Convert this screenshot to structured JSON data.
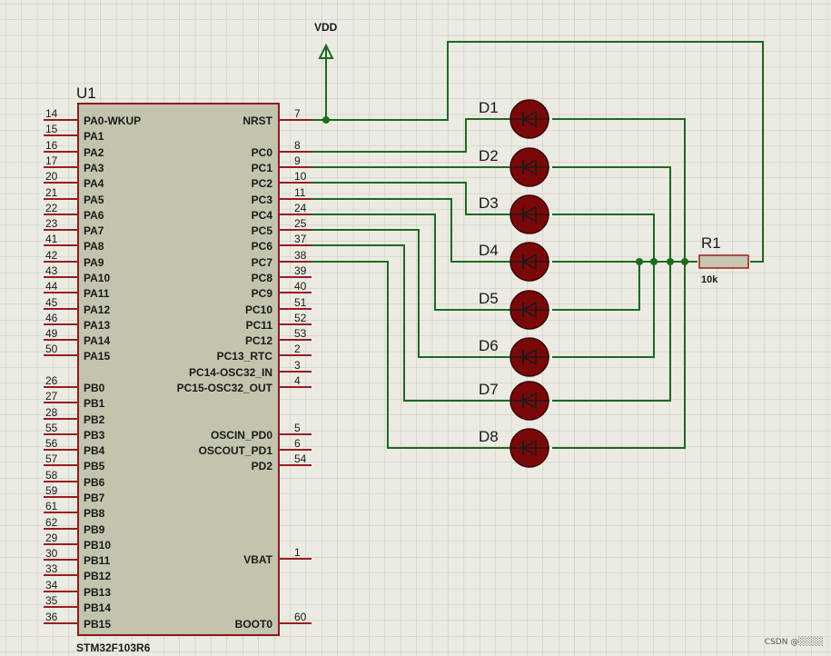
{
  "chip": {
    "ref": "U1",
    "part": "STM32F103R6",
    "left_pins": [
      {
        "num": "14",
        "label": "PA0-WKUP"
      },
      {
        "num": "15",
        "label": "PA1"
      },
      {
        "num": "16",
        "label": "PA2"
      },
      {
        "num": "17",
        "label": "PA3"
      },
      {
        "num": "20",
        "label": "PA4"
      },
      {
        "num": "21",
        "label": "PA5"
      },
      {
        "num": "22",
        "label": "PA6"
      },
      {
        "num": "23",
        "label": "PA7"
      },
      {
        "num": "41",
        "label": "PA8"
      },
      {
        "num": "42",
        "label": "PA9"
      },
      {
        "num": "43",
        "label": "PA10"
      },
      {
        "num": "44",
        "label": "PA11"
      },
      {
        "num": "45",
        "label": "PA12"
      },
      {
        "num": "46",
        "label": "PA13"
      },
      {
        "num": "49",
        "label": "PA14"
      },
      {
        "num": "50",
        "label": "PA15"
      },
      {
        "num": "26",
        "label": "PB0"
      },
      {
        "num": "27",
        "label": "PB1"
      },
      {
        "num": "28",
        "label": "PB2"
      },
      {
        "num": "55",
        "label": "PB3"
      },
      {
        "num": "56",
        "label": "PB4"
      },
      {
        "num": "57",
        "label": "PB5"
      },
      {
        "num": "58",
        "label": "PB6"
      },
      {
        "num": "59",
        "label": "PB7"
      },
      {
        "num": "61",
        "label": "PB8"
      },
      {
        "num": "62",
        "label": "PB9"
      },
      {
        "num": "29",
        "label": "PB10"
      },
      {
        "num": "30",
        "label": "PB11"
      },
      {
        "num": "33",
        "label": "PB12"
      },
      {
        "num": "34",
        "label": "PB13"
      },
      {
        "num": "35",
        "label": "PB14"
      },
      {
        "num": "36",
        "label": "PB15"
      }
    ],
    "right_pins": [
      {
        "num": "7",
        "label": "NRST"
      },
      {
        "num": "8",
        "label": "PC0"
      },
      {
        "num": "9",
        "label": "PC1"
      },
      {
        "num": "10",
        "label": "PC2"
      },
      {
        "num": "11",
        "label": "PC3"
      },
      {
        "num": "24",
        "label": "PC4"
      },
      {
        "num": "25",
        "label": "PC5"
      },
      {
        "num": "37",
        "label": "PC6"
      },
      {
        "num": "38",
        "label": "PC7"
      },
      {
        "num": "39",
        "label": "PC8"
      },
      {
        "num": "40",
        "label": "PC9"
      },
      {
        "num": "51",
        "label": "PC10"
      },
      {
        "num": "52",
        "label": "PC11"
      },
      {
        "num": "53",
        "label": "PC12"
      },
      {
        "num": "2",
        "label": "PC13_RTC"
      },
      {
        "num": "3",
        "label": "PC14-OSC32_IN"
      },
      {
        "num": "4",
        "label": "PC15-OSC32_OUT"
      },
      {
        "num": "5",
        "label": "OSCIN_PD0"
      },
      {
        "num": "6",
        "label": "OSCOUT_PD1"
      },
      {
        "num": "54",
        "label": "PD2"
      },
      {
        "num": "1",
        "label": "VBAT"
      },
      {
        "num": "60",
        "label": "BOOT0"
      }
    ]
  },
  "power": {
    "label": "VDD"
  },
  "leds": [
    "D1",
    "D2",
    "D3",
    "D4",
    "D5",
    "D6",
    "D7",
    "D8"
  ],
  "resistor": {
    "ref": "R1",
    "value": "10k"
  },
  "watermark": "CSDN @░░░░",
  "colors": {
    "background": "#ebebe3",
    "grid": "#c7c7bd",
    "wire": "#1d6a1d",
    "chip_fill": "#c4c3ad",
    "chip_border": "#8b1c1c",
    "pin": "#9b1c1c",
    "led_fill": "#7a0808",
    "led_symbol": "#1a1a1a",
    "resistor_fill": "#c8c6b0",
    "text": "#1a1a1a"
  }
}
